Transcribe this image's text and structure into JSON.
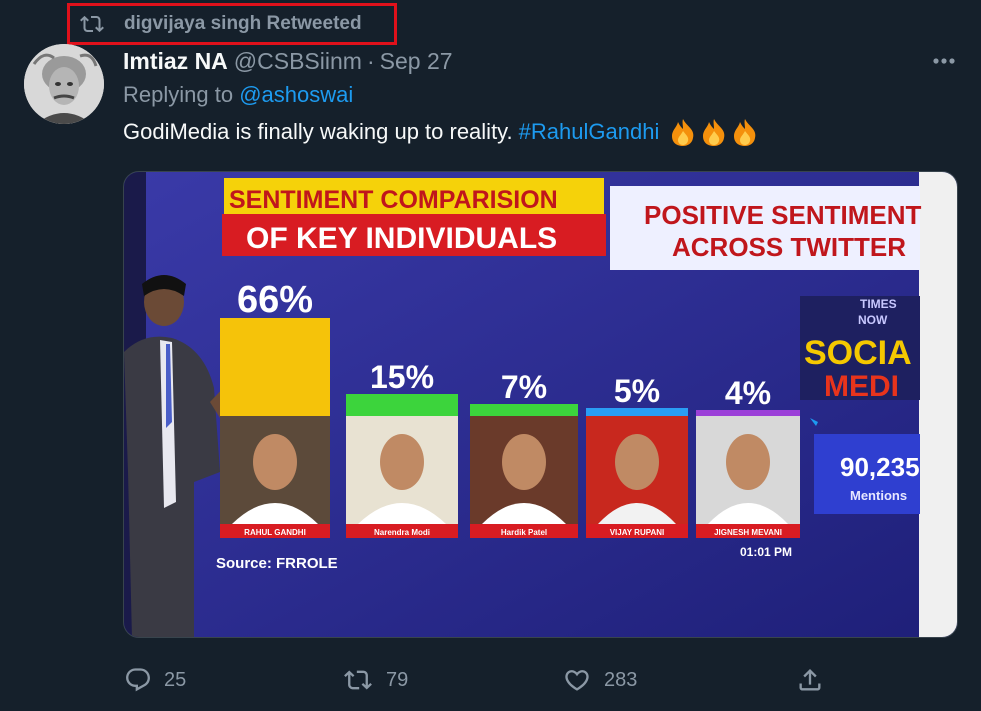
{
  "retweet_banner": {
    "text": "digvijaya singh Retweeted",
    "icon": "retweet-icon"
  },
  "tweet": {
    "author_name": "Imtiaz NA",
    "author_handle": "@CSBSiinm",
    "separator": "·",
    "date": "Sep 27",
    "replying_prefix": "Replying to",
    "replying_to": "@ashoswai",
    "text": "GodiMedia is finally waking up to reality.",
    "hashtag": "#RahulGandhi",
    "emojis": "🔥🔥🔥"
  },
  "media": {
    "headline_line1": "SENTIMENT COMPARISION",
    "headline_line2": "OF KEY INDIVIDUALS",
    "right_title_line1": "POSITIVE SENTIMENT",
    "right_title_line2": "ACROSS TWITTER",
    "brand_top": "TIMES",
    "brand_now": "NOW",
    "brand_social": "SOCIA",
    "brand_media": "MEDI",
    "mentions_value": "90,235",
    "mentions_label": "Mentions",
    "source_label": "Source: FRROLE",
    "time_label": "01:01 PM",
    "bars": [
      {
        "label": "RAHUL GANDHI",
        "value_text": "66%",
        "value": 66
      },
      {
        "label": "Narendra Modi",
        "value_text": "15%",
        "value": 15
      },
      {
        "label": "Hardik Patel",
        "value_text": "7%",
        "value": 7
      },
      {
        "label": "VIJAY RUPANI",
        "value_text": "5%",
        "value": 5
      },
      {
        "label": "JIGNESH MEVANI",
        "value_text": "4%",
        "value": 4
      }
    ]
  },
  "actions": {
    "reply_count": "25",
    "retweet_count": "79",
    "like_count": "283"
  },
  "colors": {
    "background": "#15202b",
    "link": "#1d9bf0",
    "secondary_text": "#8b98a5",
    "highlight_box": "#e0111b"
  }
}
